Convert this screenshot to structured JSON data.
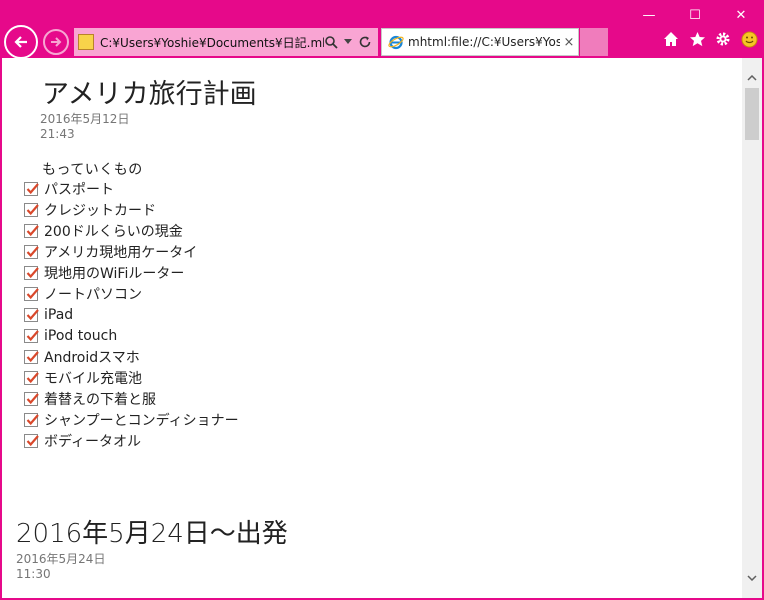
{
  "browser": {
    "address": "C:¥Users¥Yoshie¥Documents¥日記.mht",
    "tab_title": "mhtml:file://C:¥Users¥Yoshi...",
    "tab_close": "×"
  },
  "window_controls": {
    "minimize": "—",
    "maximize": "☐",
    "close": "✕"
  },
  "note": {
    "title": "アメリカ旅行計画",
    "date": "2016年5月12日",
    "time": "21:43",
    "list_heading": "もっていくもの",
    "items": [
      "パスポート",
      "クレジットカード",
      "200ドルくらいの現金",
      "アメリカ現地用ケータイ",
      "現地用のWiFiルーター",
      "ノートパソコン",
      "iPad",
      "iPod touch",
      "Androidスマホ",
      "モバイル充電池",
      "着替えの下着と服",
      "シャンプーとコンディショナー",
      "ボディータオル"
    ]
  },
  "section2": {
    "title": "2016年5月24日〜出発",
    "date": "2016年5月24日",
    "time": "11:30"
  },
  "colors": {
    "accent": "#e6098a",
    "check": "#d9482b"
  }
}
